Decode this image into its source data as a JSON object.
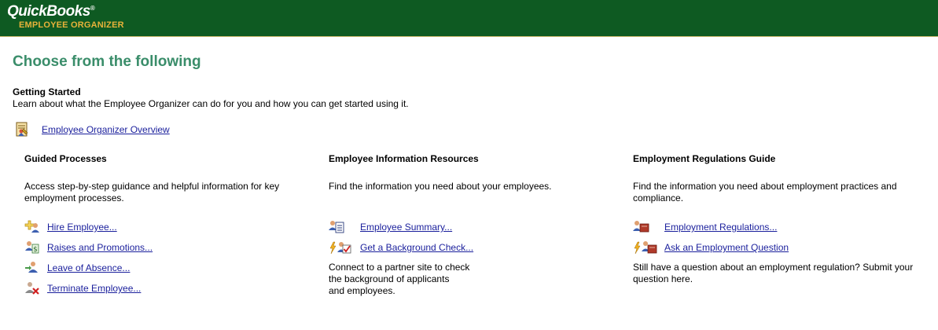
{
  "header": {
    "logo_text": "QuickBooks",
    "logo_mark": "®",
    "product_name": "EMPLOYEE ORGANIZER",
    "bg_color": "#0e5a22",
    "accent_color": "#e8b23a"
  },
  "page_title": "Choose from the following",
  "getting_started": {
    "heading": "Getting Started",
    "description": "Learn about what the Employee Organizer can do for you and how you can get started using it.",
    "overview_link": {
      "label": "Employee Organizer Overview",
      "icon": "overview-icon"
    }
  },
  "columns": [
    {
      "heading": "Guided Processes",
      "description": "Access step-by-step guidance and helpful information for key employment processes.",
      "items": [
        {
          "label": "Hire Employee...",
          "icon": "hire-employee-icon"
        },
        {
          "label": "Raises and Promotions...",
          "icon": "raises-icon"
        },
        {
          "label": "Leave of Absence...",
          "icon": "leave-icon"
        },
        {
          "label": "Terminate Employee...",
          "icon": "terminate-icon"
        }
      ]
    },
    {
      "heading": "Employee Information Resources",
      "description": "Find the information you need about your employees.",
      "items": [
        {
          "label": "Employee Summary...",
          "icon": "employee-summary-icon"
        },
        {
          "label": "Get a Background Check...",
          "icon": "background-check-icon"
        }
      ],
      "note": [
        "Connect to a partner site to check",
        "the background of applicants",
        "and employees."
      ]
    },
    {
      "heading": "Employment Regulations Guide",
      "description": "Find the information you need about employment practices and compliance.",
      "items": [
        {
          "label": "Employment Regulations...",
          "icon": "regulations-icon"
        },
        {
          "label": "Ask an Employment Question",
          "icon": "ask-question-icon"
        }
      ],
      "note": [
        "Still have a question about an employment regulation? Submit your question here."
      ]
    }
  ],
  "colors": {
    "title": "#3a8d6a",
    "link": "#1a1f9c"
  }
}
